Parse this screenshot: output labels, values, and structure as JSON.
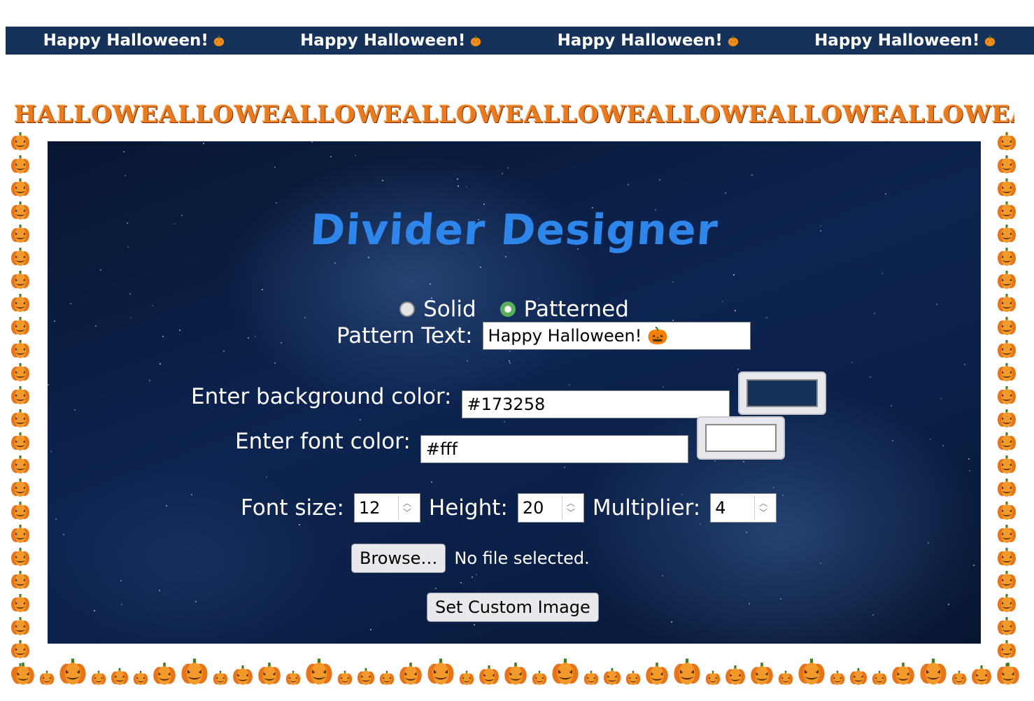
{
  "banner": {
    "items": [
      "Happy Halloween!",
      "Happy Halloween!",
      "Happy Halloween!",
      "Happy Halloween!"
    ],
    "background": "#173258",
    "icon": "pumpkin-icon"
  },
  "halloween_row": {
    "text": "HALLOWEALLOWEALLOWEALLOWEALLOWEALLOWEALLOWEALLOWEALLOWEALLOWEEN"
  },
  "app": {
    "title": "Divider Designer",
    "type_options": {
      "solid_label": "Solid",
      "patterned_label": "Patterned",
      "selected": "Patterned"
    },
    "pattern_text": {
      "label": "Pattern Text:",
      "value": "Happy Halloween! 🎃"
    },
    "background_color": {
      "label": "Enter background color:",
      "value": "#173258",
      "swatch": "#173258"
    },
    "font_color": {
      "label": "Enter font color:",
      "value": "#fff",
      "swatch": "#ffffff"
    },
    "font_size": {
      "label": "Font size:",
      "value": "12"
    },
    "height": {
      "label": "Height:",
      "value": "20"
    },
    "multiplier": {
      "label": "Multiplier:",
      "value": "4"
    },
    "file": {
      "button_label": "Browse…",
      "status": "No file selected."
    },
    "set_image_button": "Set Custom Image"
  }
}
